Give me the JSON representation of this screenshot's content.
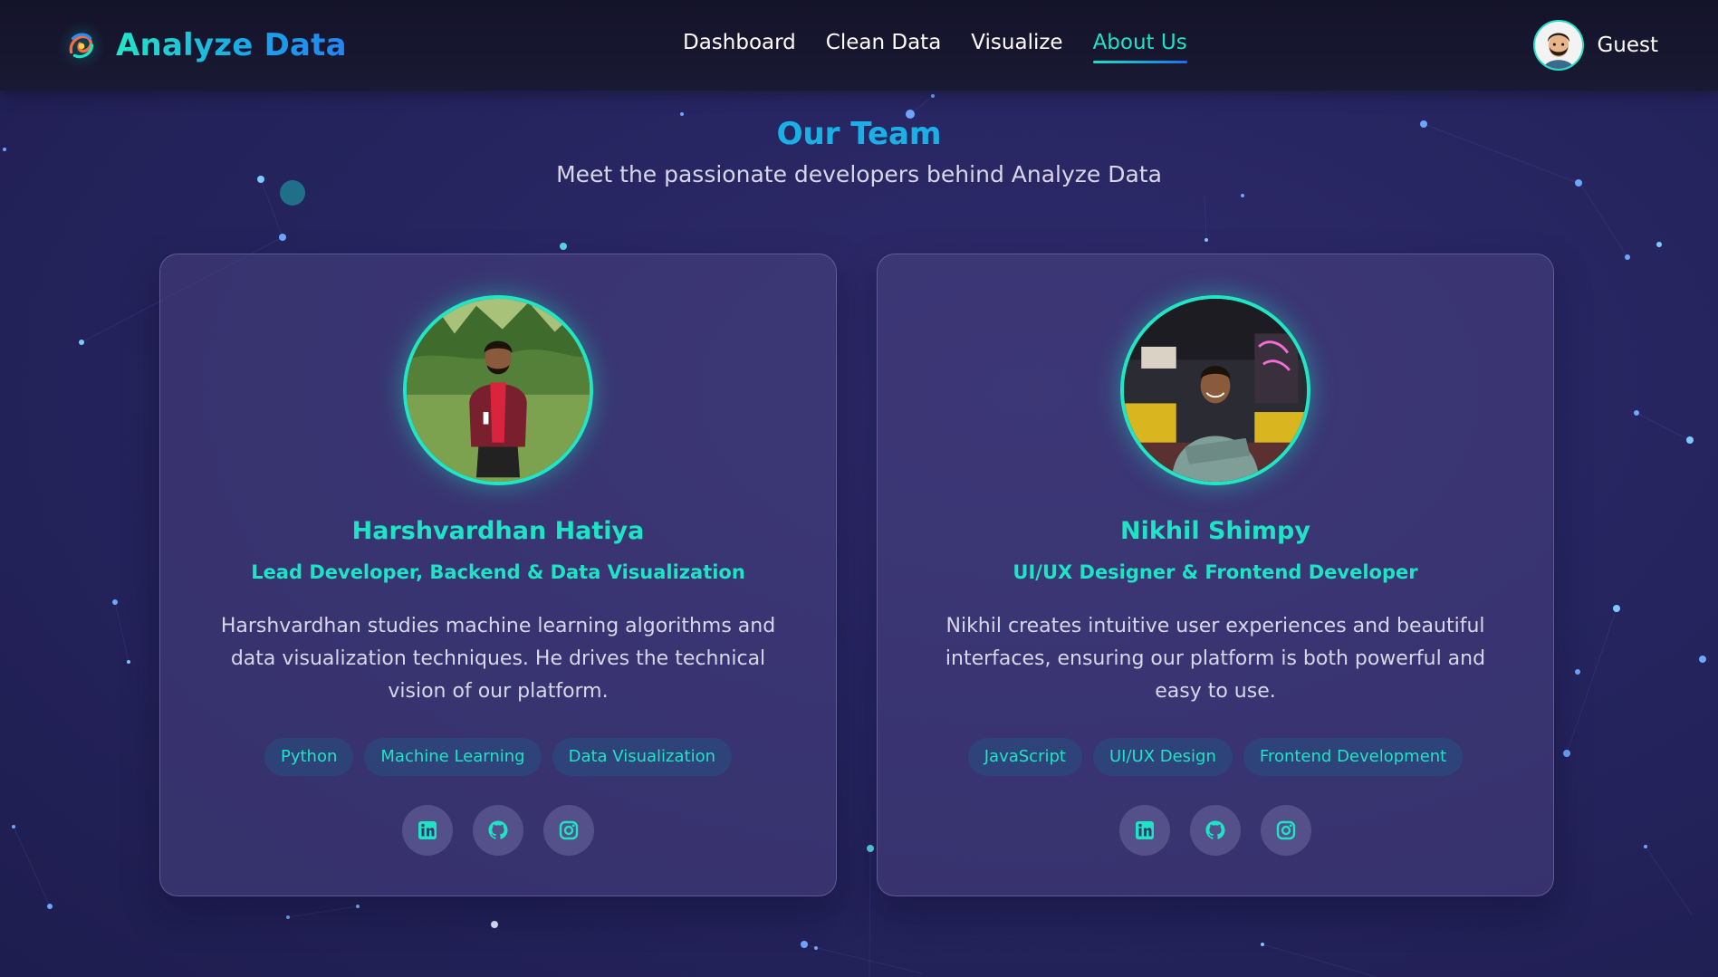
{
  "nav": {
    "brand": "Analyze Data",
    "links": [
      {
        "label": "Dashboard",
        "active": false
      },
      {
        "label": "Clean Data",
        "active": false
      },
      {
        "label": "Visualize",
        "active": false
      },
      {
        "label": "About Us",
        "active": true
      }
    ],
    "user": {
      "name": "Guest"
    }
  },
  "header": {
    "title": "Our Team",
    "subtitle": "Meet the passionate developers behind Analyze Data"
  },
  "team": [
    {
      "name": "Harshvardhan Hatiya",
      "role": "Lead Developer, Backend & Data Visualization",
      "bio": "Harshvardhan studies machine learning algorithms and data visualization techniques. He drives the technical vision of our platform.",
      "skills": [
        "Python",
        "Machine Learning",
        "Data Visualization"
      ],
      "socials": [
        "linkedin-icon",
        "github-icon",
        "instagram-icon"
      ]
    },
    {
      "name": "Nikhil Shimpy",
      "role": "UI/UX Designer & Frontend Developer",
      "bio": "Nikhil creates intuitive user experiences and beautiful interfaces, ensuring our platform is both powerful and easy to use.",
      "skills": [
        "JavaScript",
        "UI/UX Design",
        "Frontend Development"
      ],
      "socials": [
        "linkedin-icon",
        "github-icon",
        "instagram-icon"
      ]
    }
  ],
  "colors": {
    "accent": "#1ee3c5",
    "title_blue": "#1ab0e6",
    "background": "#262560"
  }
}
